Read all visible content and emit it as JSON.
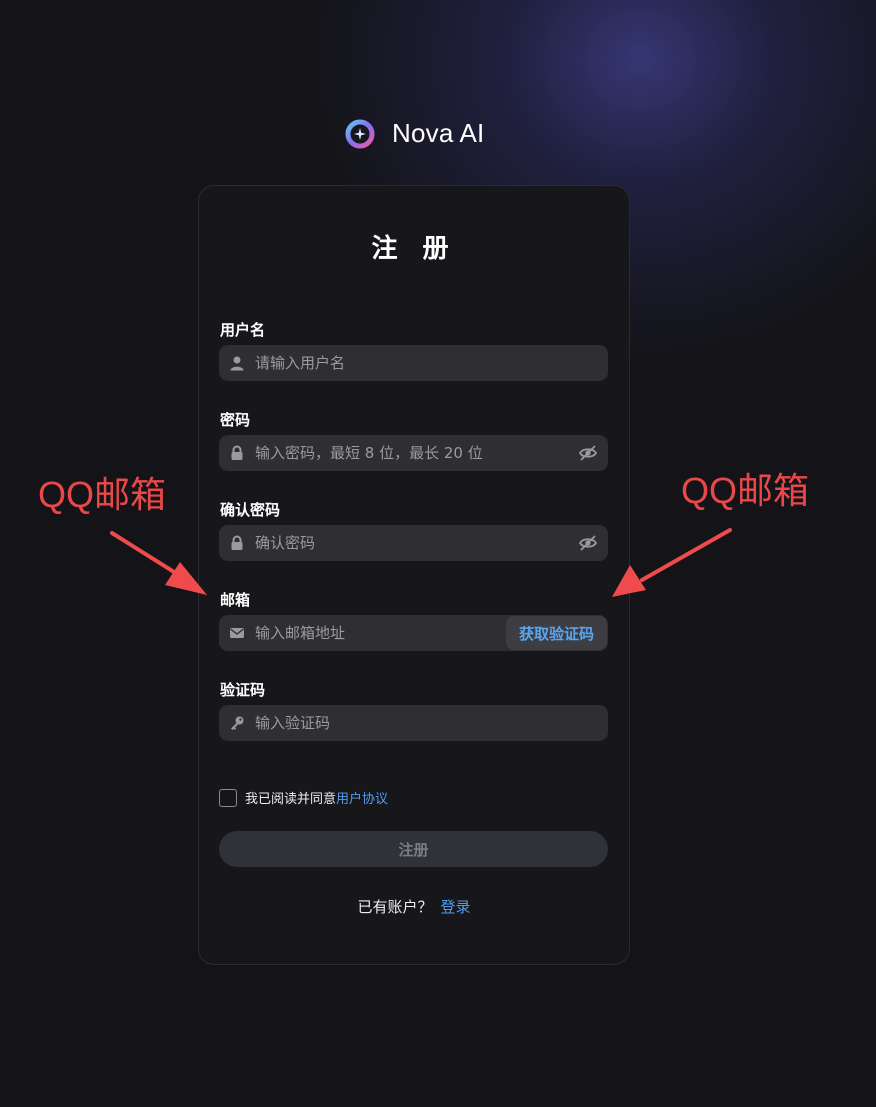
{
  "brand": {
    "name": "Nova AI"
  },
  "form": {
    "title": "注 册",
    "username": {
      "label": "用户名",
      "placeholder": "请输入用户名"
    },
    "password": {
      "label": "密码",
      "placeholder": "输入密码，最短 8 位，最长 20 位"
    },
    "confirm": {
      "label": "确认密码",
      "placeholder": "确认密码"
    },
    "email": {
      "label": "邮箱",
      "placeholder": "输入邮箱地址",
      "code_button": "获取验证码"
    },
    "code": {
      "label": "验证码",
      "placeholder": "输入验证码"
    },
    "agree": {
      "text": "我已阅读并同意",
      "link": "用户协议"
    },
    "submit_label": "注册",
    "login": {
      "text": "已有账户？",
      "link": "登录"
    }
  },
  "annotations": {
    "left": "QQ邮箱",
    "right": "QQ邮箱"
  },
  "colors": {
    "accent_link": "#4f9df0",
    "annotation": "#e8484a",
    "card_bg": "#17171b",
    "input_bg": "#2e2e33"
  },
  "icons": {
    "brand": "nova-logo-icon",
    "username": "user-icon",
    "password": "lock-icon",
    "confirm": "lock-icon",
    "email": "mail-icon",
    "code": "key-icon",
    "toggle": "eye-off-icon"
  }
}
